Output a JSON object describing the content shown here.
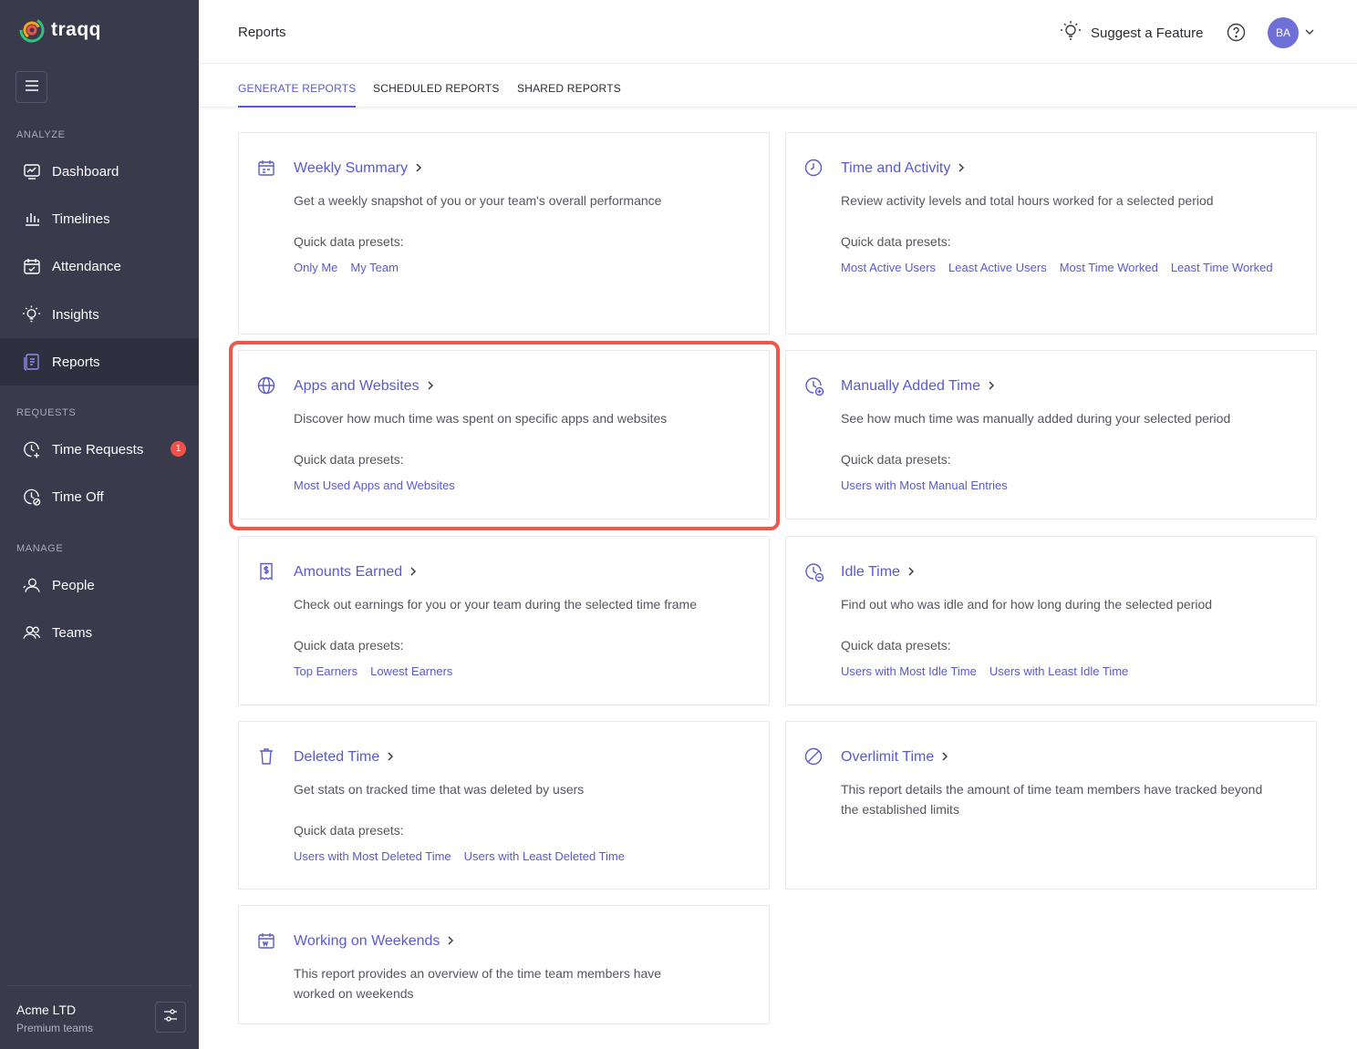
{
  "app": {
    "logo_text": "traqq",
    "brand_color": "#5a5ad0",
    "sidebar_color": "#393a4b"
  },
  "sidebar": {
    "sections": {
      "analyze": "ANALYZE",
      "requests": "REQUESTS",
      "manage": "MANAGE"
    },
    "items": [
      {
        "label": "Dashboard",
        "icon": "dashboard-icon"
      },
      {
        "label": "Timelines",
        "icon": "bar-chart-icon"
      },
      {
        "label": "Attendance",
        "icon": "calendar-check-icon"
      },
      {
        "label": "Insights",
        "icon": "lightbulb-icon"
      },
      {
        "label": "Reports",
        "icon": "report-icon",
        "active": true
      },
      {
        "label": "Time Requests",
        "icon": "clock-plus-icon",
        "badge": "1"
      },
      {
        "label": "Time Off",
        "icon": "clock-off-icon"
      },
      {
        "label": "People",
        "icon": "person-icon"
      },
      {
        "label": "Teams",
        "icon": "team-icon"
      }
    ],
    "footer": {
      "org_name": "Acme LTD",
      "org_plan": "Premium teams"
    }
  },
  "header": {
    "title": "Reports",
    "suggest_label": "Suggest a Feature",
    "avatar_initials": "BA"
  },
  "tabs": [
    {
      "label": "GENERATE REPORTS",
      "active": true
    },
    {
      "label": "SCHEDULED REPORTS"
    },
    {
      "label": "SHARED REPORTS"
    }
  ],
  "cards": [
    {
      "title": "Weekly Summary",
      "icon": "calendar-icon",
      "description": "Get a weekly snapshot of you or your team's overall performance",
      "presets_label": "Quick data presets:",
      "presets": [
        "Only Me",
        "My Team"
      ]
    },
    {
      "title": "Time and Activity",
      "icon": "clock-icon",
      "description": "Review activity levels and total hours worked for a selected period",
      "presets_label": "Quick data presets:",
      "presets": [
        "Most Active Users",
        "Least Active Users",
        "Most Time Worked",
        "Least Time Worked"
      ]
    },
    {
      "title": "Apps and Websites",
      "icon": "globe-icon",
      "description": "Discover how much time was spent on specific apps and websites",
      "presets_label": "Quick data presets:",
      "presets": [
        "Most Used Apps and Websites"
      ]
    },
    {
      "title": "Manually Added Time",
      "icon": "clock-plus-icon",
      "description": "See how much time was manually added during your selected period",
      "presets_label": "Quick data presets:",
      "presets": [
        "Users with Most Manual Entries"
      ]
    },
    {
      "title": "Amounts Earned",
      "icon": "dollar-receipt-icon",
      "description": "Check out earnings for you or your team during the selected time frame",
      "presets_label": "Quick data presets:",
      "presets": [
        "Top Earners",
        "Lowest Earners"
      ]
    },
    {
      "title": "Idle Time",
      "icon": "clock-minus-icon",
      "description": "Find out who was idle and for how long during the selected period",
      "presets_label": "Quick data presets:",
      "presets": [
        "Users with Most Idle Time",
        "Users with Least Idle Time"
      ]
    },
    {
      "title": "Deleted Time",
      "icon": "trash-icon",
      "description": "Get stats on tracked time that was deleted by users",
      "presets_label": "Quick data presets:",
      "presets": [
        "Users with Most Deleted Time",
        "Users with Least Deleted Time"
      ]
    },
    {
      "title": "Overlimit Time",
      "icon": "prohibited-icon",
      "description": "This report details the amount of time team members have tracked beyond the established limits"
    },
    {
      "title": "Working on Weekends",
      "icon": "calendar-weekend-icon",
      "description": "This report provides an overview of the time team members have worked on weekends"
    }
  ]
}
